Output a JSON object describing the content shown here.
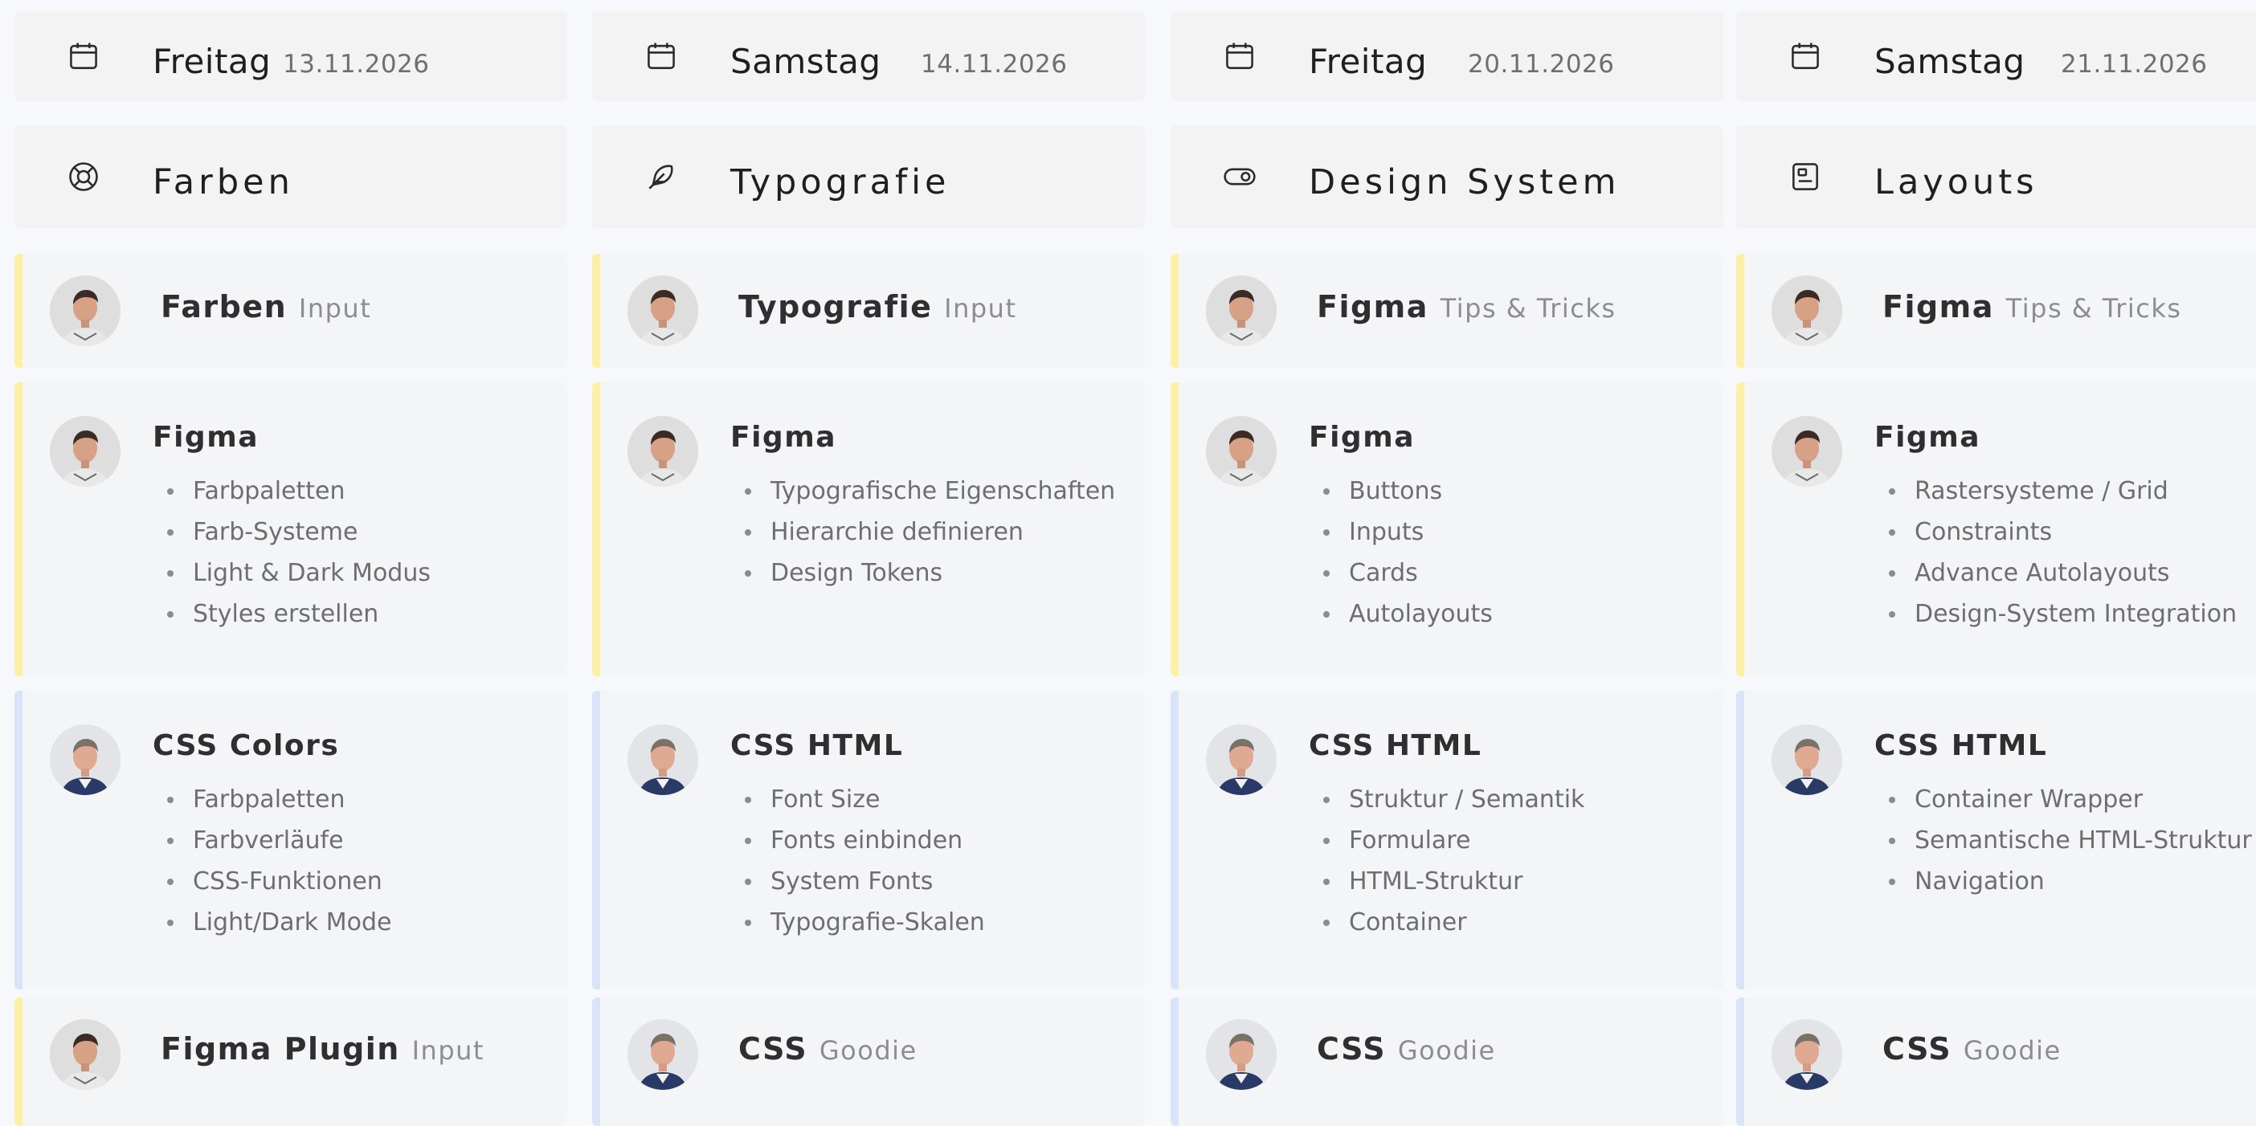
{
  "columns": [
    {
      "day": {
        "name": "Freitag",
        "date": "13.11.2026",
        "icon": "calendar-icon"
      },
      "topic": {
        "name": "Farben",
        "icon": "lifebuoy-icon"
      },
      "slot1": {
        "title": "Farben",
        "sub": "Input",
        "accent": "yellow",
        "speaker": "speaker-a"
      },
      "slot2": {
        "title": "Figma",
        "accent": "yellow",
        "speaker": "speaker-a",
        "items": [
          "Farbpaletten",
          "Farb-Systeme",
          "Light & Dark Modus",
          "Styles erstellen"
        ]
      },
      "slot3": {
        "title": "CSS Colors",
        "accent": "blue",
        "speaker": "speaker-b",
        "items": [
          "Farbpaletten",
          "Farbverläufe",
          "CSS-Funktionen",
          "Light/Dark Mode"
        ]
      },
      "slot4": {
        "title": "Figma Plugin",
        "sub": "Input",
        "accent": "yellow",
        "speaker": "speaker-a"
      }
    },
    {
      "day": {
        "name": "Samstag",
        "date": "14.11.2026",
        "icon": "calendar-icon"
      },
      "topic": {
        "name": "Typografie",
        "icon": "feather-icon"
      },
      "slot1": {
        "title": "Typografie",
        "sub": "Input",
        "accent": "yellow",
        "speaker": "speaker-a"
      },
      "slot2": {
        "title": "Figma",
        "accent": "yellow",
        "speaker": "speaker-a",
        "items": [
          "Typografische Eigenschaften",
          "Hierarchie definieren",
          "Design Tokens"
        ]
      },
      "slot3": {
        "title": "CSS HTML",
        "accent": "blue",
        "speaker": "speaker-b",
        "items": [
          "Font Size",
          "Fonts einbinden",
          "System Fonts",
          "Typografie-Skalen"
        ]
      },
      "slot4": {
        "title": "CSS",
        "sub": "Goodie",
        "accent": "blue",
        "speaker": "speaker-b"
      }
    },
    {
      "day": {
        "name": "Freitag",
        "date": "20.11.2026",
        "icon": "calendar-icon"
      },
      "topic": {
        "name": "Design System",
        "icon": "toggle-icon"
      },
      "slot1": {
        "title": "Figma",
        "sub": "Tips & Tricks",
        "accent": "yellow",
        "speaker": "speaker-a"
      },
      "slot2": {
        "title": "Figma",
        "accent": "yellow",
        "speaker": "speaker-a",
        "items": [
          "Buttons",
          "Inputs",
          "Cards",
          "Autolayouts"
        ]
      },
      "slot3": {
        "title": "CSS HTML",
        "accent": "blue",
        "speaker": "speaker-b",
        "items": [
          "Struktur / Semantik",
          "Formulare",
          "HTML-Struktur",
          "Container"
        ]
      },
      "slot4": {
        "title": "CSS",
        "sub": "Goodie",
        "accent": "blue",
        "speaker": "speaker-b"
      }
    },
    {
      "day": {
        "name": "Samstag",
        "date": "21.11.2026",
        "icon": "calendar-icon"
      },
      "topic": {
        "name": "Layouts",
        "icon": "layout-icon"
      },
      "slot1": {
        "title": "Figma",
        "sub": "Tips & Tricks",
        "accent": "yellow",
        "speaker": "speaker-a"
      },
      "slot2": {
        "title": "Figma",
        "accent": "yellow",
        "speaker": "speaker-a",
        "items": [
          "Rastersysteme / Grid",
          "Constraints",
          "Advance Autolayouts",
          "Design-System Integration"
        ]
      },
      "slot3": {
        "title": "CSS HTML",
        "accent": "blue",
        "speaker": "speaker-b",
        "items": [
          "Container Wrapper",
          "Semantische HTML-Struktur",
          "Navigation"
        ]
      },
      "slot4": {
        "title": "CSS",
        "sub": "Goodie",
        "accent": "blue",
        "speaker": "speaker-b"
      }
    }
  ],
  "colors": {
    "yellow": "#fdf0a6",
    "blue": "#d9e4fb",
    "card": "#f3f3f3",
    "background": "#f7f8fb"
  }
}
